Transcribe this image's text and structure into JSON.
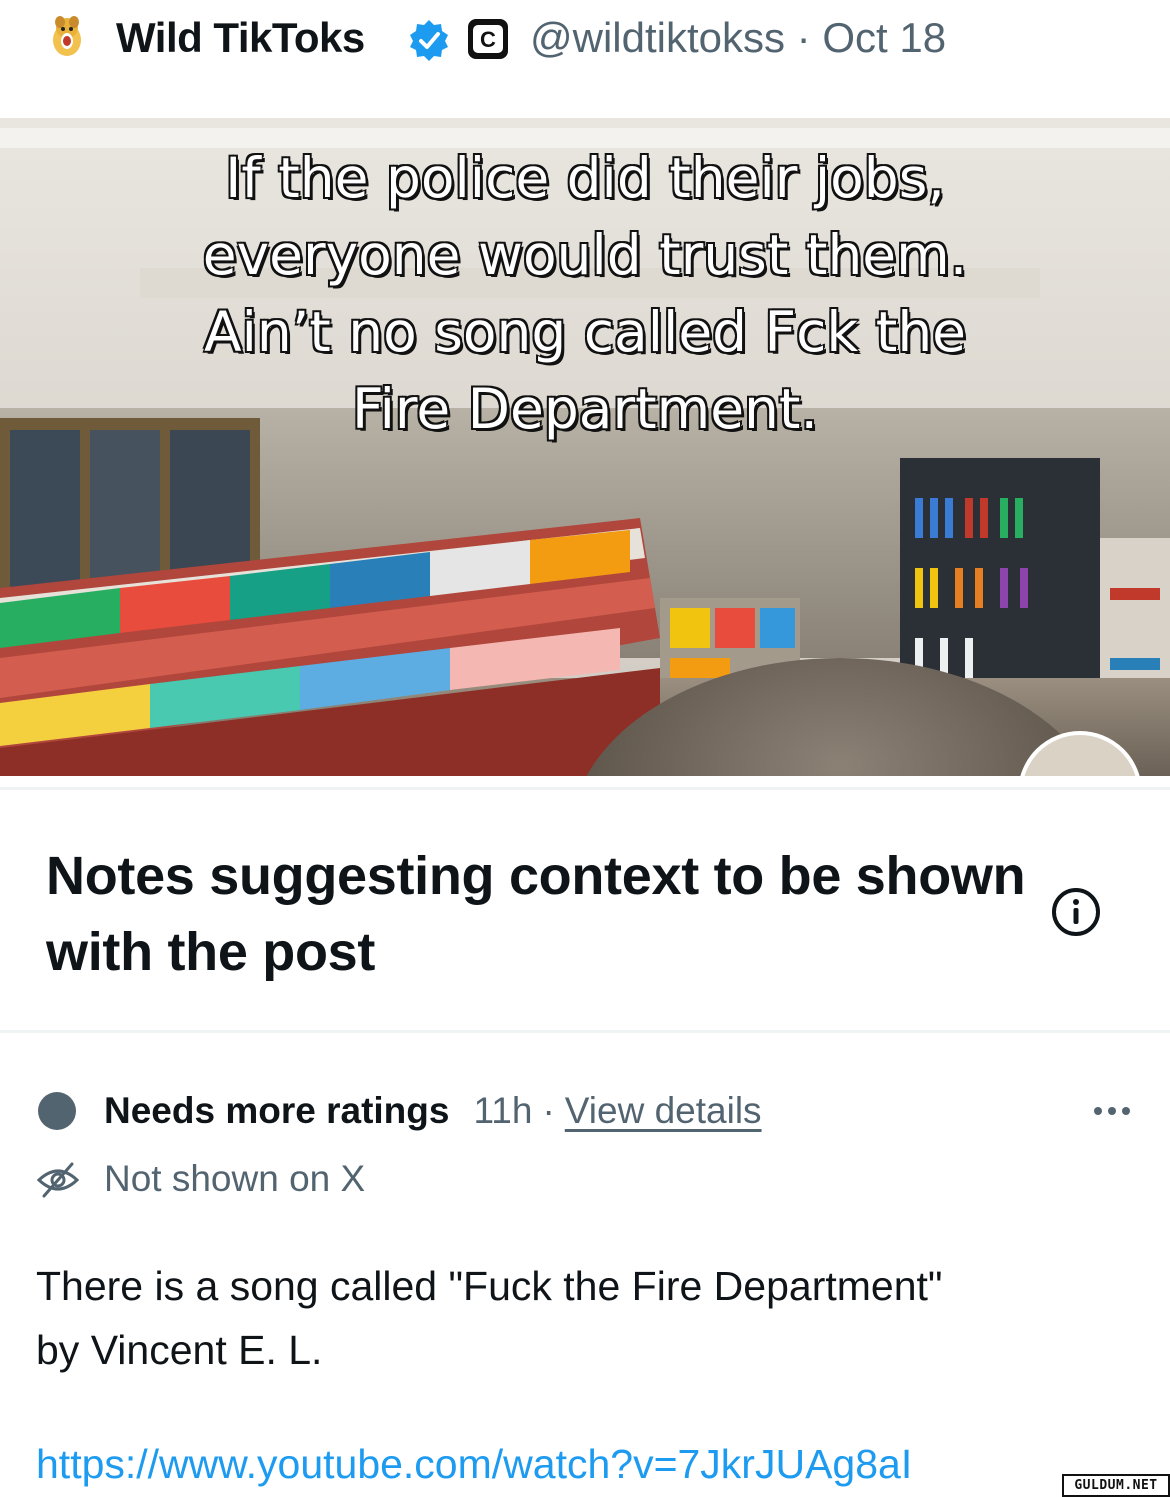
{
  "tweet": {
    "display_name": "Wild TikToks",
    "affiliate_badge_letter": "C",
    "handle_and_date": "@wildtiktokss · Oct 18",
    "verified_color": "#1d9bf0"
  },
  "media": {
    "caption_lines": [
      "If the police did their jobs,",
      "everyone would trust them.",
      "Ain’t no song called Fck the",
      "Fire Department."
    ]
  },
  "notes_section": {
    "title": "Notes suggesting context to be shown with the post",
    "info_icon": "info-circle-icon"
  },
  "note": {
    "status": "Needs more ratings",
    "age": "11h",
    "separator": "·",
    "details_link": "View details",
    "visibility": "Not shown on X",
    "body_lines": [
      "There is a song called \"Fuck the Fire Department\"",
      "by Vincent E. L."
    ],
    "link": "https://www.youtube.com/watch?v=7JkrJUAg8aI",
    "link_color": "#1d9bf0"
  },
  "watermark": "GULDUM.NET"
}
